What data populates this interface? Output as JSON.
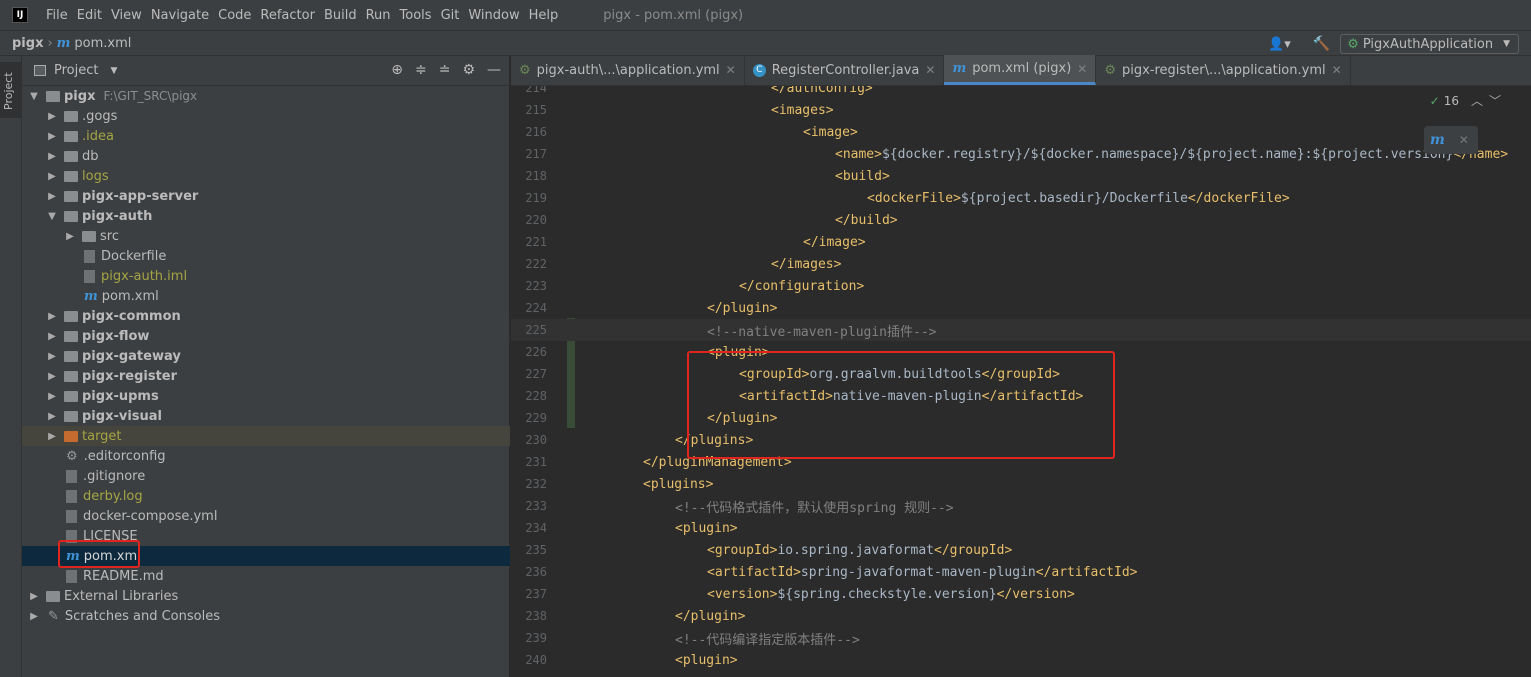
{
  "menubar": {
    "logo": "IJ",
    "items": [
      "File",
      "Edit",
      "View",
      "Navigate",
      "Code",
      "Refactor",
      "Build",
      "Run",
      "Tools",
      "Git",
      "Window",
      "Help"
    ],
    "window_title": "pigx - pom.xml (pigx)"
  },
  "navbar": {
    "project": "pigx",
    "maven_glyph": "m",
    "file": "pom.xml",
    "run_config": "PigxAuthApplication",
    "user_glyph": "👤▾",
    "hammer_glyph": "🔨",
    "dropdown_glyph": "▼"
  },
  "sidebar": {
    "project_tab": "Project"
  },
  "panel": {
    "title": "Project",
    "title_chevron": "▼",
    "tool_icons": [
      "⊕",
      "≑",
      "≐",
      "⚙",
      "—"
    ]
  },
  "tree": [
    {
      "arrow": "▼",
      "icon": "folder",
      "label": "pigx",
      "path": "F:\\GIT_SRC\\pigx",
      "bold": true,
      "indent": 0
    },
    {
      "arrow": "▶",
      "icon": "folder",
      "label": ".gogs",
      "indent": 1
    },
    {
      "arrow": "▶",
      "icon": "folder",
      "label": ".idea",
      "olive": true,
      "indent": 1
    },
    {
      "arrow": "▶",
      "icon": "folder",
      "label": "db",
      "indent": 1
    },
    {
      "arrow": "▶",
      "icon": "folder",
      "label": "logs",
      "olive": true,
      "indent": 1
    },
    {
      "arrow": "▶",
      "icon": "folder",
      "label": "pigx-app-server",
      "bold": true,
      "indent": 1
    },
    {
      "arrow": "▼",
      "icon": "folder",
      "label": "pigx-auth",
      "bold": true,
      "indent": 1
    },
    {
      "arrow": "▶",
      "icon": "folder",
      "label": "src",
      "indent": 2
    },
    {
      "arrow": "",
      "icon": "file",
      "label": "Dockerfile",
      "indent": 2
    },
    {
      "arrow": "",
      "icon": "file",
      "label": "pigx-auth.iml",
      "olive": true,
      "indent": 2
    },
    {
      "arrow": "",
      "icon": "maven",
      "label": "pom.xml",
      "indent": 2
    },
    {
      "arrow": "▶",
      "icon": "folder",
      "label": "pigx-common",
      "bold": true,
      "indent": 1
    },
    {
      "arrow": "▶",
      "icon": "folder",
      "label": "pigx-flow",
      "bold": true,
      "indent": 1
    },
    {
      "arrow": "▶",
      "icon": "folder",
      "label": "pigx-gateway",
      "bold": true,
      "indent": 1
    },
    {
      "arrow": "▶",
      "icon": "folder",
      "label": "pigx-register",
      "bold": true,
      "indent": 1
    },
    {
      "arrow": "▶",
      "icon": "folder",
      "label": "pigx-upms",
      "bold": true,
      "indent": 1
    },
    {
      "arrow": "▶",
      "icon": "folder",
      "label": "pigx-visual",
      "bold": true,
      "indent": 1
    },
    {
      "arrow": "▶",
      "icon": "folder-orange",
      "label": "target",
      "olive": true,
      "excluded": true,
      "indent": 1
    },
    {
      "arrow": "",
      "icon": "gear",
      "label": ".editorconfig",
      "indent": 1
    },
    {
      "arrow": "",
      "icon": "file",
      "label": ".gitignore",
      "indent": 1
    },
    {
      "arrow": "",
      "icon": "file",
      "label": "derby.log",
      "olive": true,
      "indent": 1
    },
    {
      "arrow": "",
      "icon": "file",
      "label": "docker-compose.yml",
      "indent": 1
    },
    {
      "arrow": "",
      "icon": "file",
      "label": "LICENSE",
      "indent": 1
    },
    {
      "arrow": "",
      "icon": "maven",
      "label": "pom.xml",
      "selected": true,
      "indent": 1
    },
    {
      "arrow": "",
      "icon": "file",
      "label": "README.md",
      "indent": 1
    },
    {
      "arrow": "▶",
      "icon": "lib",
      "label": "External Libraries",
      "indent": 0
    },
    {
      "arrow": "▶",
      "icon": "scratch",
      "label": "Scratches and Consoles",
      "indent": 0
    }
  ],
  "tabs": [
    {
      "label": "pigx-auth\\...\\application.yml",
      "icon": "yml",
      "active": false
    },
    {
      "label": "RegisterController.java",
      "icon": "class",
      "active": false
    },
    {
      "label": "pom.xml (pigx)",
      "icon": "maven",
      "active": true
    },
    {
      "label": "pigx-register\\...\\application.yml",
      "icon": "yml",
      "active": false
    }
  ],
  "tab_glyphs": {
    "close": "✕",
    "yml": "⚙",
    "class": "C",
    "maven": "m"
  },
  "inspection": {
    "check": "✓",
    "count": "16",
    "up": "︿",
    "down": "﹀"
  },
  "maven_popup": {
    "icon": "m",
    "close": "✕"
  },
  "code_lines": [
    {
      "n": "214",
      "indent": 6,
      "parts": [
        [
          "tag",
          "</authConfig>"
        ]
      ]
    },
    {
      "n": "215",
      "indent": 6,
      "parts": [
        [
          "tag",
          "<images>"
        ]
      ]
    },
    {
      "n": "216",
      "indent": 7,
      "parts": [
        [
          "tag",
          "<image>"
        ]
      ]
    },
    {
      "n": "217",
      "indent": 8,
      "parts": [
        [
          "tag",
          "<name>"
        ],
        [
          "txt",
          "${docker.registry}/${docker.namespace}/${project.name}:${project.version}"
        ],
        [
          "tag",
          "</name>"
        ]
      ]
    },
    {
      "n": "218",
      "indent": 8,
      "parts": [
        [
          "tag",
          "<build>"
        ]
      ]
    },
    {
      "n": "219",
      "indent": 9,
      "parts": [
        [
          "tag",
          "<dockerFile>"
        ],
        [
          "txt",
          "${project.basedir}/Dockerfile"
        ],
        [
          "tag",
          "</dockerFile>"
        ]
      ]
    },
    {
      "n": "220",
      "indent": 8,
      "parts": [
        [
          "tag",
          "</build>"
        ]
      ]
    },
    {
      "n": "221",
      "indent": 7,
      "parts": [
        [
          "tag",
          "</image>"
        ]
      ]
    },
    {
      "n": "222",
      "indent": 6,
      "parts": [
        [
          "tag",
          "</images>"
        ]
      ]
    },
    {
      "n": "223",
      "indent": 5,
      "parts": [
        [
          "tag",
          "</configuration>"
        ]
      ]
    },
    {
      "n": "224",
      "indent": 4,
      "parts": [
        [
          "tag",
          "</plugin>"
        ]
      ]
    },
    {
      "n": "225",
      "indent": 4,
      "parts": [
        [
          "cmt",
          "<!--native-maven-plugin插件-->"
        ]
      ],
      "caret": true
    },
    {
      "n": "226",
      "indent": 4,
      "parts": [
        [
          "tag",
          "<plugin>"
        ]
      ]
    },
    {
      "n": "227",
      "indent": 5,
      "parts": [
        [
          "tag",
          "<groupId>"
        ],
        [
          "txt",
          "org.graalvm.buildtools"
        ],
        [
          "tag",
          "</groupId>"
        ]
      ]
    },
    {
      "n": "228",
      "indent": 5,
      "parts": [
        [
          "tag",
          "<artifactId>"
        ],
        [
          "txt",
          "native-maven-plugin"
        ],
        [
          "tag",
          "</artifactId>"
        ]
      ]
    },
    {
      "n": "229",
      "indent": 4,
      "parts": [
        [
          "tag",
          "</plugin>"
        ]
      ]
    },
    {
      "n": "230",
      "indent": 3,
      "parts": [
        [
          "tag",
          "</plugins>"
        ]
      ]
    },
    {
      "n": "231",
      "indent": 2,
      "parts": [
        [
          "tag",
          "</pluginManagement>"
        ]
      ]
    },
    {
      "n": "232",
      "indent": 2,
      "parts": [
        [
          "tag",
          "<plugins>"
        ]
      ]
    },
    {
      "n": "233",
      "indent": 3,
      "parts": [
        [
          "cmt",
          "<!--代码格式插件，默认使用spring 规则-->"
        ]
      ]
    },
    {
      "n": "234",
      "indent": 3,
      "parts": [
        [
          "tag",
          "<plugin>"
        ]
      ]
    },
    {
      "n": "235",
      "indent": 4,
      "parts": [
        [
          "tag",
          "<groupId>"
        ],
        [
          "txt",
          "io.spring.javaformat"
        ],
        [
          "tag",
          "</groupId>"
        ]
      ]
    },
    {
      "n": "236",
      "indent": 4,
      "parts": [
        [
          "tag",
          "<artifactId>"
        ],
        [
          "txt",
          "spring-javaformat-maven-plugin"
        ],
        [
          "tag",
          "</artifactId>"
        ]
      ]
    },
    {
      "n": "237",
      "indent": 4,
      "parts": [
        [
          "tag",
          "<version>"
        ],
        [
          "txt",
          "${spring.checkstyle.version}"
        ],
        [
          "tag",
          "</version>"
        ]
      ]
    },
    {
      "n": "238",
      "indent": 3,
      "parts": [
        [
          "tag",
          "</plugin>"
        ]
      ]
    },
    {
      "n": "239",
      "indent": 3,
      "parts": [
        [
          "cmt",
          "<!--代码编译指定版本插件-->"
        ]
      ]
    },
    {
      "n": "240",
      "indent": 3,
      "parts": [
        [
          "tag",
          "<plugin>"
        ]
      ]
    }
  ]
}
